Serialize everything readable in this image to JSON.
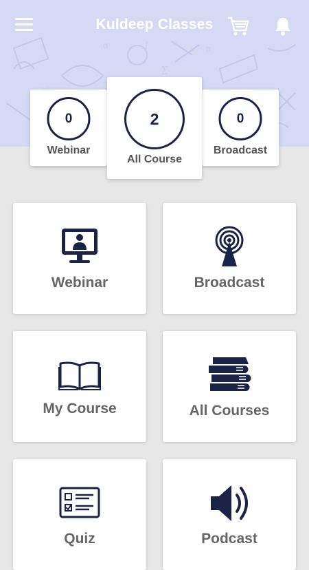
{
  "app": {
    "title": "Kuldeep Classes"
  },
  "colors": {
    "header_bg": "#d5d9f3",
    "accent": "#1a2346",
    "page_bg": "#e7e7e7"
  },
  "stats": {
    "webinar": {
      "count": "0",
      "label": "Webinar"
    },
    "all_course": {
      "count": "2",
      "label": "All Course"
    },
    "broadcast": {
      "count": "0",
      "label": "Broadcast"
    }
  },
  "tiles": [
    {
      "label": "Webinar",
      "icon": "webinar-monitor-icon"
    },
    {
      "label": "Broadcast",
      "icon": "broadcast-antenna-icon"
    },
    {
      "label": "My Course",
      "icon": "open-book-icon"
    },
    {
      "label": "All Courses",
      "icon": "book-stack-icon"
    },
    {
      "label": "Quiz",
      "icon": "quiz-checklist-icon"
    },
    {
      "label": "Podcast",
      "icon": "speaker-icon"
    }
  ]
}
